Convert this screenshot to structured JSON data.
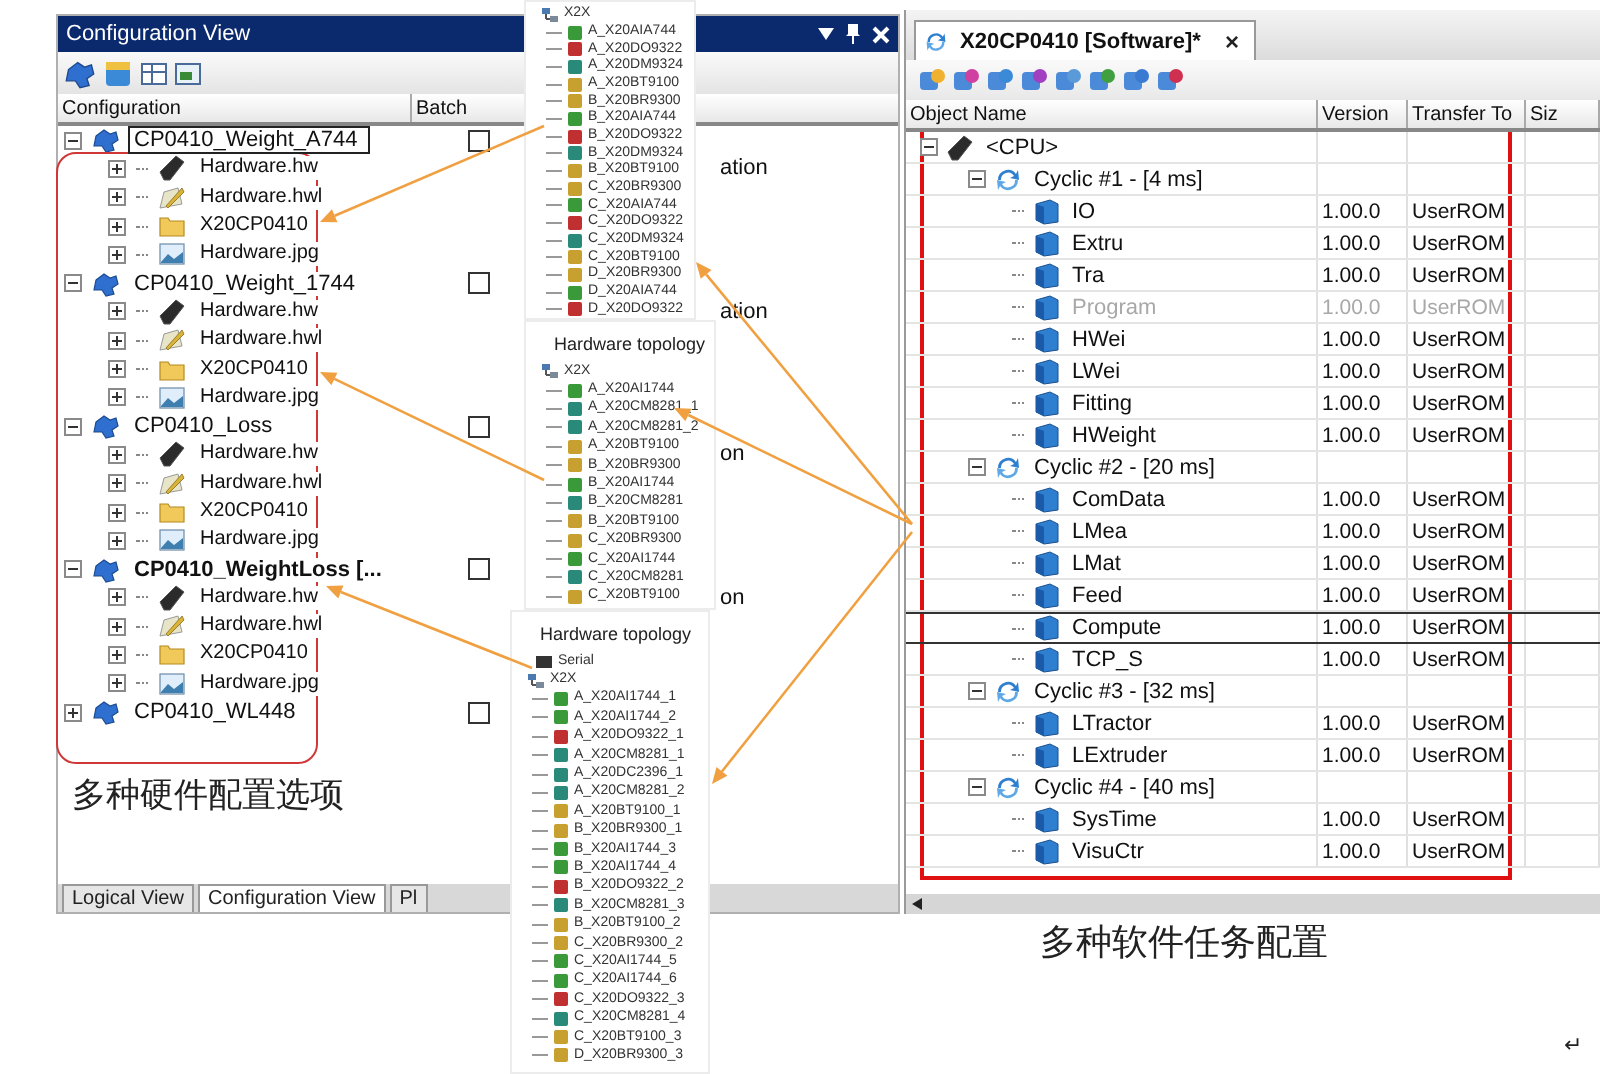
{
  "configuration_view": {
    "title": "Configuration View",
    "columns": [
      "Configuration",
      "Batch"
    ],
    "items": [
      {
        "name": "CP0410_Weight_A744",
        "selected": true,
        "active": false,
        "expanded": true,
        "checked": false,
        "children": [
          {
            "kind": "hw",
            "name": "Hardware.hw",
            "column_3": "ation"
          },
          {
            "kind": "hwl",
            "name": "Hardware.hwl"
          },
          {
            "kind": "folder",
            "name": "X20CP0410"
          },
          {
            "kind": "jpg",
            "name": "Hardware.jpg"
          }
        ]
      },
      {
        "name": "CP0410_Weight_1744",
        "selected": false,
        "active": false,
        "expanded": true,
        "checked": false,
        "children": [
          {
            "kind": "hw",
            "name": "Hardware.hw",
            "column_3": "ation"
          },
          {
            "kind": "hwl",
            "name": "Hardware.hwl"
          },
          {
            "kind": "folder",
            "name": "X20CP0410"
          },
          {
            "kind": "jpg",
            "name": "Hardware.jpg"
          }
        ]
      },
      {
        "name": "CP0410_Loss",
        "selected": false,
        "active": false,
        "expanded": true,
        "checked": false,
        "children": [
          {
            "kind": "hw",
            "name": "Hardware.hw",
            "column_3": "on"
          },
          {
            "kind": "hwl",
            "name": "Hardware.hwl"
          },
          {
            "kind": "folder",
            "name": "X20CP0410"
          },
          {
            "kind": "jpg",
            "name": "Hardware.jpg"
          }
        ]
      },
      {
        "name": "CP0410_WeightLoss [...",
        "selected": false,
        "active": true,
        "expanded": true,
        "checked": false,
        "children": [
          {
            "kind": "hw",
            "name": "Hardware.hw",
            "column_3": "on"
          },
          {
            "kind": "hwl",
            "name": "Hardware.hwl"
          },
          {
            "kind": "folder",
            "name": "X20CP0410"
          },
          {
            "kind": "jpg",
            "name": "Hardware.jpg"
          }
        ]
      },
      {
        "name": "CP0410_WL448",
        "selected": false,
        "active": false,
        "expanded": false,
        "checked": false
      }
    ],
    "tabs": [
      {
        "label": "Logical View",
        "selected": false
      },
      {
        "label": "Configuration View",
        "selected": true
      },
      {
        "label": "Pl",
        "selected": false
      }
    ]
  },
  "topology_panels": [
    {
      "root": "X2X",
      "items": [
        {
          "name": "A_X20AIA744",
          "color": "#3a9a3a"
        },
        {
          "name": "A_X20DO9322",
          "color": "#c03030"
        },
        {
          "name": "A_X20DM9324",
          "color": "#2a8a7a"
        },
        {
          "name": "A_X20BT9100",
          "color": "#c8a030"
        },
        {
          "name": "B_X20BR9300",
          "color": "#c8a030"
        },
        {
          "name": "B_X20AIA744",
          "color": "#3a9a3a"
        },
        {
          "name": "B_X20DO9322",
          "color": "#c03030"
        },
        {
          "name": "B_X20DM9324",
          "color": "#2a8a7a"
        },
        {
          "name": "B_X20BT9100",
          "color": "#c8a030"
        },
        {
          "name": "C_X20BR9300",
          "color": "#c8a030"
        },
        {
          "name": "C_X20AIA744",
          "color": "#3a9a3a"
        },
        {
          "name": "C_X20DO9322",
          "color": "#c03030"
        },
        {
          "name": "C_X20DM9324",
          "color": "#2a8a7a"
        },
        {
          "name": "C_X20BT9100",
          "color": "#c8a030"
        },
        {
          "name": "D_X20BR9300",
          "color": "#c8a030"
        },
        {
          "name": "D_X20AIA744",
          "color": "#3a9a3a"
        },
        {
          "name": "D_X20DO9322",
          "color": "#c03030"
        }
      ]
    },
    {
      "title": "Hardware topology",
      "root": "X2X",
      "items": [
        {
          "name": "A_X20AI1744",
          "color": "#3a9a3a"
        },
        {
          "name": "A_X20CM8281_1",
          "color": "#2a8a7a"
        },
        {
          "name": "A_X20CM8281_2",
          "color": "#2a8a7a"
        },
        {
          "name": "A_X20BT9100",
          "color": "#c8a030"
        },
        {
          "name": "B_X20BR9300",
          "color": "#c8a030"
        },
        {
          "name": "B_X20AI1744",
          "color": "#3a9a3a"
        },
        {
          "name": "B_X20CM8281",
          "color": "#2a8a7a"
        },
        {
          "name": "B_X20BT9100",
          "color": "#c8a030"
        },
        {
          "name": "C_X20BR9300",
          "color": "#c8a030"
        },
        {
          "name": "C_X20AI1744",
          "color": "#3a9a3a"
        },
        {
          "name": "C_X20CM8281",
          "color": "#2a8a7a"
        },
        {
          "name": "C_X20BT9100",
          "color": "#c8a030"
        }
      ]
    },
    {
      "title": "Hardware topology",
      "other_nodes": [
        "Serial"
      ],
      "root": "X2X",
      "items": [
        {
          "name": "A_X20AI1744_1",
          "color": "#3a9a3a"
        },
        {
          "name": "A_X20AI1744_2",
          "color": "#3a9a3a"
        },
        {
          "name": "A_X20DO9322_1",
          "color": "#c03030"
        },
        {
          "name": "A_X20CM8281_1",
          "color": "#2a8a7a"
        },
        {
          "name": "A_X20DC2396_1",
          "color": "#2a8a7a"
        },
        {
          "name": "A_X20CM8281_2",
          "color": "#2a8a7a"
        },
        {
          "name": "A_X20BT9100_1",
          "color": "#c8a030"
        },
        {
          "name": "B_X20BR9300_1",
          "color": "#c8a030"
        },
        {
          "name": "B_X20AI1744_3",
          "color": "#3a9a3a"
        },
        {
          "name": "B_X20AI1744_4",
          "color": "#3a9a3a"
        },
        {
          "name": "B_X20DO9322_2",
          "color": "#c03030"
        },
        {
          "name": "B_X20CM8281_3",
          "color": "#2a8a7a"
        },
        {
          "name": "B_X20BT9100_2",
          "color": "#c8a030"
        },
        {
          "name": "C_X20BR9300_2",
          "color": "#c8a030"
        },
        {
          "name": "C_X20AI1744_5",
          "color": "#3a9a3a"
        },
        {
          "name": "C_X20AI1744_6",
          "color": "#3a9a3a"
        },
        {
          "name": "C_X20DO9322_3",
          "color": "#c03030"
        },
        {
          "name": "C_X20CM8281_4",
          "color": "#2a8a7a"
        },
        {
          "name": "C_X20BT9100_3",
          "color": "#c8a030"
        },
        {
          "name": "D_X20BR9300_3",
          "color": "#c8a030"
        }
      ]
    }
  ],
  "software_view": {
    "tab": {
      "label": "X20CP0410 [Software]*",
      "close": "×"
    },
    "columns": [
      "Object Name",
      "Version",
      "Transfer To",
      "Siz"
    ],
    "tree": {
      "kind": "cpu",
      "name": "<CPU>",
      "expanded": true,
      "children": [
        {
          "kind": "cyclic",
          "name": "Cyclic #1 - [4 ms]",
          "expanded": true,
          "children": [
            {
              "kind": "task",
              "name": "IO",
              "version": "1.00.0",
              "transfer_to": "UserROM",
              "disabled": false,
              "selected": false
            },
            {
              "kind": "task",
              "name": "Extru",
              "version": "1.00.0",
              "transfer_to": "UserROM",
              "disabled": false,
              "selected": false
            },
            {
              "kind": "task",
              "name": "Tra",
              "version": "1.00.0",
              "transfer_to": "UserROM",
              "disabled": false,
              "selected": false
            },
            {
              "kind": "task",
              "name": "Program",
              "version": "1.00.0",
              "transfer_to": "UserROM",
              "disabled": true,
              "selected": false
            },
            {
              "kind": "task",
              "name": "HWei",
              "version": "1.00.0",
              "transfer_to": "UserROM",
              "disabled": false,
              "selected": false
            },
            {
              "kind": "task",
              "name": "LWei",
              "version": "1.00.0",
              "transfer_to": "UserROM",
              "disabled": false,
              "selected": false
            },
            {
              "kind": "task",
              "name": "Fitting",
              "version": "1.00.0",
              "transfer_to": "UserROM",
              "disabled": false,
              "selected": false
            },
            {
              "kind": "task",
              "name": "HWeight",
              "version": "1.00.0",
              "transfer_to": "UserROM",
              "disabled": false,
              "selected": false
            }
          ]
        },
        {
          "kind": "cyclic",
          "name": "Cyclic #2 - [20 ms]",
          "expanded": true,
          "children": [
            {
              "kind": "task",
              "name": "ComData",
              "version": "1.00.0",
              "transfer_to": "UserROM",
              "disabled": false,
              "selected": false
            },
            {
              "kind": "task",
              "name": "LMea",
              "version": "1.00.0",
              "transfer_to": "UserROM",
              "disabled": false,
              "selected": false
            },
            {
              "kind": "task",
              "name": "LMat",
              "version": "1.00.0",
              "transfer_to": "UserROM",
              "disabled": false,
              "selected": false
            },
            {
              "kind": "task",
              "name": "Feed",
              "version": "1.00.0",
              "transfer_to": "UserROM",
              "disabled": false,
              "selected": false
            },
            {
              "kind": "task",
              "name": "Compute",
              "version": "1.00.0",
              "transfer_to": "UserROM",
              "disabled": false,
              "selected": true
            },
            {
              "kind": "task",
              "name": "TCP_S",
              "version": "1.00.0",
              "transfer_to": "UserROM",
              "disabled": false,
              "selected": false
            }
          ]
        },
        {
          "kind": "cyclic",
          "name": "Cyclic #3 - [32 ms]",
          "expanded": true,
          "children": [
            {
              "kind": "task",
              "name": "LTractor",
              "version": "1.00.0",
              "transfer_to": "UserROM",
              "disabled": false,
              "selected": false
            },
            {
              "kind": "task",
              "name": "LExtruder",
              "version": "1.00.0",
              "transfer_to": "UserROM",
              "disabled": false,
              "selected": false
            }
          ]
        },
        {
          "kind": "cyclic",
          "name": "Cyclic #4 - [40 ms]",
          "expanded": true,
          "children": [
            {
              "kind": "task",
              "name": "SysTime",
              "version": "1.00.0",
              "transfer_to": "UserROM",
              "disabled": false,
              "selected": false
            },
            {
              "kind": "task",
              "name": "VisuCtr",
              "version": "1.00.0",
              "transfer_to": "UserROM",
              "disabled": false,
              "selected": false
            }
          ]
        }
      ]
    }
  },
  "captions": {
    "hardware": "多种硬件配置选项",
    "software": "多种软件任务配置"
  },
  "paragraph_mark": "↵"
}
